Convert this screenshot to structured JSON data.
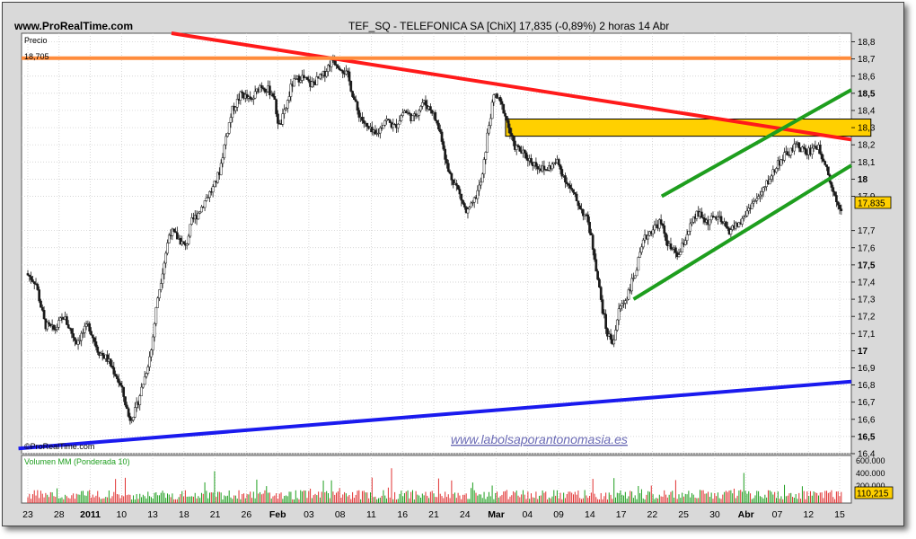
{
  "header": {
    "site": "www.ProRealTime.com",
    "title": "TEF_SQ - TELEFONICA SA [ChiX]    17,835 (-0,89%)    2 horas  14 Abr"
  },
  "price_panel": {
    "label": "Precio",
    "ref_value_label": "18,705",
    "watermark": "©ProRealTime.com",
    "site_link": "www.labolsaporantonomasia.es",
    "last_price_label": "17,835"
  },
  "volume_panel": {
    "label": "Volumen MM (Ponderada 10)",
    "value_label": "110,215",
    "axis_labels": [
      "600.000",
      "400.000",
      "200.000"
    ]
  },
  "colors": {
    "resistance": "#ff1a1a",
    "support_long": "#1a1aee",
    "horizontal": "#ff8c3c",
    "channel": "#1e9e1e",
    "zone_fill": "#ffd000",
    "candles": "#1a1a1a",
    "volume": "#1e9e1e",
    "volume_down": "#e03030"
  },
  "chart_data": {
    "type": "candlestick",
    "title": "TEF_SQ - TELEFONICA SA [ChiX]",
    "interval": "2 horas",
    "last": 17.835,
    "change_pct": -0.89,
    "ylim": [
      16.4,
      18.85
    ],
    "y_ticks": [
      {
        "v": 18.8,
        "label": "18,8"
      },
      {
        "v": 18.7,
        "label": "18,7"
      },
      {
        "v": 18.6,
        "label": "18,6"
      },
      {
        "v": 18.5,
        "label": "18,5",
        "bold": true
      },
      {
        "v": 18.4,
        "label": "18,4"
      },
      {
        "v": 18.3,
        "label": "18,3"
      },
      {
        "v": 18.2,
        "label": "18,2"
      },
      {
        "v": 18.1,
        "label": "18,1"
      },
      {
        "v": 18.0,
        "label": "18",
        "bold": true
      },
      {
        "v": 17.9,
        "label": "17,9"
      },
      {
        "v": 17.7,
        "label": "17,7"
      },
      {
        "v": 17.6,
        "label": "17,6"
      },
      {
        "v": 17.5,
        "label": "17,5",
        "bold": true
      },
      {
        "v": 17.4,
        "label": "17,4"
      },
      {
        "v": 17.3,
        "label": "17,3"
      },
      {
        "v": 17.2,
        "label": "17,2"
      },
      {
        "v": 17.1,
        "label": "17,1"
      },
      {
        "v": 17.0,
        "label": "17",
        "bold": true
      },
      {
        "v": 16.9,
        "label": "16,9"
      },
      {
        "v": 16.8,
        "label": "16,8"
      },
      {
        "v": 16.7,
        "label": "16,7"
      },
      {
        "v": 16.6,
        "label": "16,6"
      },
      {
        "v": 16.5,
        "label": "16,5",
        "bold": true
      },
      {
        "v": 16.4,
        "label": "16,4"
      }
    ],
    "x_labels": [
      {
        "i": 0,
        "label": "23"
      },
      {
        "i": 1,
        "label": "28"
      },
      {
        "i": 2,
        "label": "2011",
        "bold": true
      },
      {
        "i": 3,
        "label": "10"
      },
      {
        "i": 4,
        "label": "13"
      },
      {
        "i": 5,
        "label": "18"
      },
      {
        "i": 6,
        "label": "21"
      },
      {
        "i": 7,
        "label": "26"
      },
      {
        "i": 8,
        "label": "Feb",
        "bold": true
      },
      {
        "i": 9,
        "label": "03"
      },
      {
        "i": 10,
        "label": "08"
      },
      {
        "i": 11,
        "label": "11"
      },
      {
        "i": 12,
        "label": "16"
      },
      {
        "i": 13,
        "label": "21"
      },
      {
        "i": 14,
        "label": "24"
      },
      {
        "i": 15,
        "label": "Mar",
        "bold": true
      },
      {
        "i": 16,
        "label": "04"
      },
      {
        "i": 17,
        "label": "09"
      },
      {
        "i": 18,
        "label": "14"
      },
      {
        "i": 19,
        "label": "17"
      },
      {
        "i": 20,
        "label": "22"
      },
      {
        "i": 21,
        "label": "25"
      },
      {
        "i": 22,
        "label": "30"
      },
      {
        "i": 23,
        "label": "Abr",
        "bold": true
      },
      {
        "i": 24,
        "label": "07"
      },
      {
        "i": 25,
        "label": "12"
      },
      {
        "i": 26,
        "label": "15"
      }
    ],
    "price_path": [
      [
        0,
        17.45
      ],
      [
        0.3,
        17.4
      ],
      [
        0.6,
        17.15
      ],
      [
        0.9,
        17.12
      ],
      [
        1.2,
        17.2
      ],
      [
        1.6,
        17.05
      ],
      [
        2.0,
        17.15
      ],
      [
        2.3,
        17.0
      ],
      [
        2.6,
        16.95
      ],
      [
        2.9,
        16.85
      ],
      [
        3.1,
        16.75
      ],
      [
        3.3,
        16.6
      ],
      [
        3.5,
        16.65
      ],
      [
        3.8,
        16.85
      ],
      [
        4.0,
        17.0
      ],
      [
        4.2,
        17.3
      ],
      [
        4.4,
        17.5
      ],
      [
        4.6,
        17.7
      ],
      [
        4.9,
        17.65
      ],
      [
        5.1,
        17.6
      ],
      [
        5.3,
        17.75
      ],
      [
        5.5,
        17.8
      ],
      [
        5.8,
        17.9
      ],
      [
        6.0,
        17.95
      ],
      [
        6.2,
        18.05
      ],
      [
        6.4,
        18.25
      ],
      [
        6.6,
        18.4
      ],
      [
        6.9,
        18.5
      ],
      [
        7.2,
        18.45
      ],
      [
        7.5,
        18.55
      ],
      [
        7.9,
        18.5
      ],
      [
        8.1,
        18.3
      ],
      [
        8.3,
        18.4
      ],
      [
        8.5,
        18.55
      ],
      [
        8.8,
        18.6
      ],
      [
        9.1,
        18.55
      ],
      [
        9.5,
        18.6
      ],
      [
        9.8,
        18.7
      ],
      [
        10.1,
        18.65
      ],
      [
        10.3,
        18.6
      ],
      [
        10.6,
        18.4
      ],
      [
        10.9,
        18.3
      ],
      [
        11.2,
        18.25
      ],
      [
        11.5,
        18.35
      ],
      [
        11.8,
        18.3
      ],
      [
        12.1,
        18.4
      ],
      [
        12.4,
        18.35
      ],
      [
        12.7,
        18.45
      ],
      [
        13.0,
        18.4
      ],
      [
        13.3,
        18.25
      ],
      [
        13.5,
        18.05
      ],
      [
        13.8,
        17.95
      ],
      [
        14.1,
        17.8
      ],
      [
        14.3,
        17.85
      ],
      [
        14.6,
        18.0
      ],
      [
        14.8,
        18.3
      ],
      [
        15.0,
        18.5
      ],
      [
        15.3,
        18.4
      ],
      [
        15.6,
        18.2
      ],
      [
        15.9,
        18.15
      ],
      [
        16.2,
        18.1
      ],
      [
        16.6,
        18.05
      ],
      [
        17.0,
        18.1
      ],
      [
        17.4,
        17.95
      ],
      [
        17.7,
        17.85
      ],
      [
        18.0,
        17.75
      ],
      [
        18.2,
        17.55
      ],
      [
        18.4,
        17.3
      ],
      [
        18.6,
        17.1
      ],
      [
        18.8,
        17.05
      ],
      [
        19.0,
        17.25
      ],
      [
        19.2,
        17.3
      ],
      [
        19.5,
        17.45
      ],
      [
        19.8,
        17.65
      ],
      [
        20.0,
        17.7
      ],
      [
        20.3,
        17.75
      ],
      [
        20.6,
        17.6
      ],
      [
        20.9,
        17.55
      ],
      [
        21.2,
        17.7
      ],
      [
        21.5,
        17.8
      ],
      [
        21.8,
        17.75
      ],
      [
        22.1,
        17.78
      ],
      [
        22.5,
        17.7
      ],
      [
        22.9,
        17.75
      ],
      [
        23.2,
        17.85
      ],
      [
        23.5,
        17.9
      ],
      [
        23.8,
        18.0
      ],
      [
        24.1,
        18.1
      ],
      [
        24.4,
        18.15
      ],
      [
        24.7,
        18.2
      ],
      [
        25.0,
        18.15
      ],
      [
        25.3,
        18.2
      ],
      [
        25.6,
        18.1
      ],
      [
        25.8,
        17.95
      ],
      [
        26.0,
        17.85
      ],
      [
        26.1,
        17.835
      ]
    ],
    "lines": [
      {
        "name": "resistance",
        "p1": [
          4.6,
          18.85
        ],
        "p2": [
          27.0,
          18.23
        ],
        "color": "#ff1a1a"
      },
      {
        "name": "support",
        "p1": [
          -0.3,
          16.43
        ],
        "p2": [
          27.0,
          16.82
        ],
        "color": "#1a1aee"
      },
      {
        "name": "horizontal",
        "y": 18.705,
        "color": "#ff8c3c"
      },
      {
        "name": "channel_upper",
        "p1": [
          20.3,
          17.9
        ],
        "p2": [
          27.0,
          18.52
        ],
        "color": "#1e9e1e"
      },
      {
        "name": "channel_lower",
        "p1": [
          19.4,
          17.3
        ],
        "p2": [
          27.0,
          18.08
        ],
        "color": "#1e9e1e"
      }
    ],
    "zone": {
      "x_from": 15.3,
      "x_to": 27.0,
      "y_from": 18.25,
      "y_to": 18.35
    },
    "volume_axis": [
      0,
      800000
    ]
  }
}
